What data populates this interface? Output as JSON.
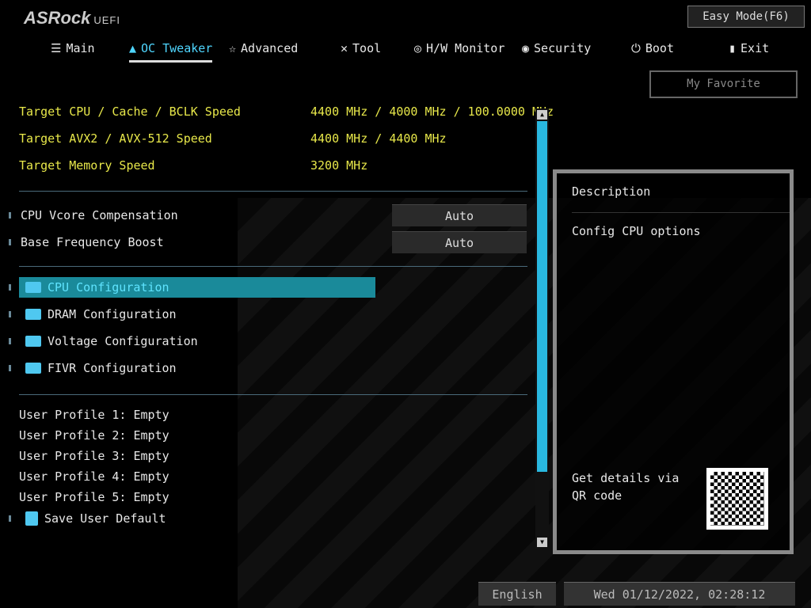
{
  "header": {
    "logo": "ASRock",
    "logo_sub": "UEFI",
    "easy_mode": "Easy Mode(F6)",
    "my_favorite": "My Favorite"
  },
  "tabs": [
    {
      "label": "Main",
      "icon": "list-icon",
      "glyph": "☰"
    },
    {
      "label": "OC Tweaker",
      "icon": "rocket-icon",
      "glyph": "▲"
    },
    {
      "label": "Advanced",
      "icon": "star-icon",
      "glyph": "☆"
    },
    {
      "label": "Tool",
      "icon": "tools-icon",
      "glyph": "✕"
    },
    {
      "label": "H/W Monitor",
      "icon": "monitor-icon",
      "glyph": "◎"
    },
    {
      "label": "Security",
      "icon": "shield-icon",
      "glyph": "◉"
    },
    {
      "label": "Boot",
      "icon": "power-icon",
      "glyph": "⏻"
    },
    {
      "label": "Exit",
      "icon": "exit-icon",
      "glyph": "▮"
    }
  ],
  "targets": [
    {
      "label": "Target CPU / Cache / BCLK Speed",
      "value": "4400 MHz / 4000 MHz / 100.0000 MHz"
    },
    {
      "label": "Target AVX2 / AVX-512 Speed",
      "value": "4400 MHz / 4400 MHz"
    },
    {
      "label": "Target Memory Speed",
      "value": "3200 MHz"
    }
  ],
  "options": [
    {
      "label": "CPU Vcore Compensation",
      "value": "Auto"
    },
    {
      "label": "Base Frequency Boost",
      "value": "Auto"
    }
  ],
  "submenus": [
    "CPU Configuration",
    "DRAM Configuration",
    "Voltage Configuration",
    "FIVR Configuration"
  ],
  "profiles": [
    "User Profile 1: Empty",
    "User Profile 2: Empty",
    "User Profile 3: Empty",
    "User Profile 4: Empty",
    "User Profile 5: Empty"
  ],
  "save_default": "Save User Default",
  "description": {
    "title": "Description",
    "text": "Config CPU options",
    "qr_text": "Get details via QR code"
  },
  "footer": {
    "language": "English",
    "datetime": "Wed 01/12/2022, 02:28:12"
  }
}
